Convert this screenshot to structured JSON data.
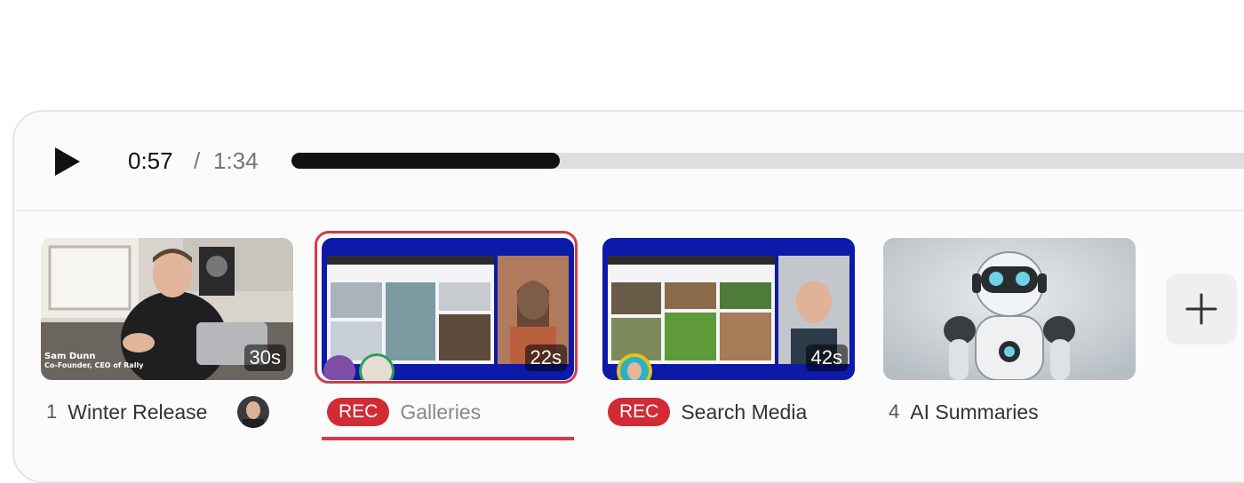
{
  "player": {
    "current_time": "0:57",
    "separator": "/",
    "total_time": "1:34",
    "progress": 0.27
  },
  "clips": [
    {
      "index": "1",
      "title": "Winter Release",
      "duration": "30s",
      "overlay_name": "Sam Dunn",
      "overlay_role": "Co-Founder, CEO of Rally"
    },
    {
      "rec_label": "REC",
      "title": "Galleries",
      "duration": "22s",
      "selected": true
    },
    {
      "rec_label": "REC",
      "title": "Search Media",
      "duration": "42s"
    },
    {
      "index": "4",
      "title": "AI Summaries"
    }
  ],
  "colors": {
    "accent": "#d43a47",
    "rec_badge": "#d22b36",
    "progress_fill": "#111111",
    "progress_track": "#dedede",
    "screen_bg": "#0d1aa8"
  },
  "icons": {
    "play": "play-icon",
    "add": "plus-icon"
  }
}
